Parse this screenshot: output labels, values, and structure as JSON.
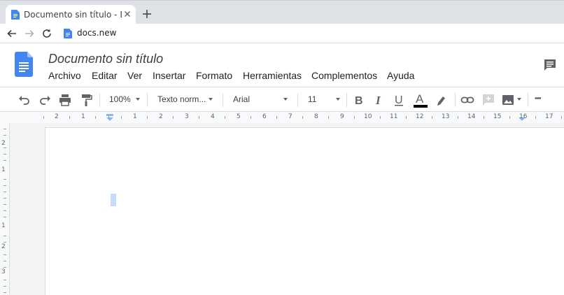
{
  "browser": {
    "tab_title": "Documento sin título - Documen",
    "url": "docs.new"
  },
  "docs": {
    "title": "Documento sin título",
    "menu": [
      "Archivo",
      "Editar",
      "Ver",
      "Insertar",
      "Formato",
      "Herramientas",
      "Complementos",
      "Ayuda"
    ]
  },
  "toolbar": {
    "zoom": "100%",
    "style": "Texto norm...",
    "font": "Arial",
    "font_size": "11",
    "more": "•••"
  },
  "ruler": {
    "numbers": [
      "2",
      "1",
      "1",
      "2",
      "3",
      "4",
      "5",
      "6",
      "7",
      "8",
      "9",
      "10",
      "11",
      "12",
      "13",
      "14",
      "15",
      "16",
      "17"
    ],
    "vertical_numbers": [
      "2",
      "1",
      "1",
      "2",
      "3"
    ]
  },
  "colors": {
    "docs_blue": "#4285f4",
    "text_color_bar": "#000000",
    "selection": "#c6dafc"
  }
}
